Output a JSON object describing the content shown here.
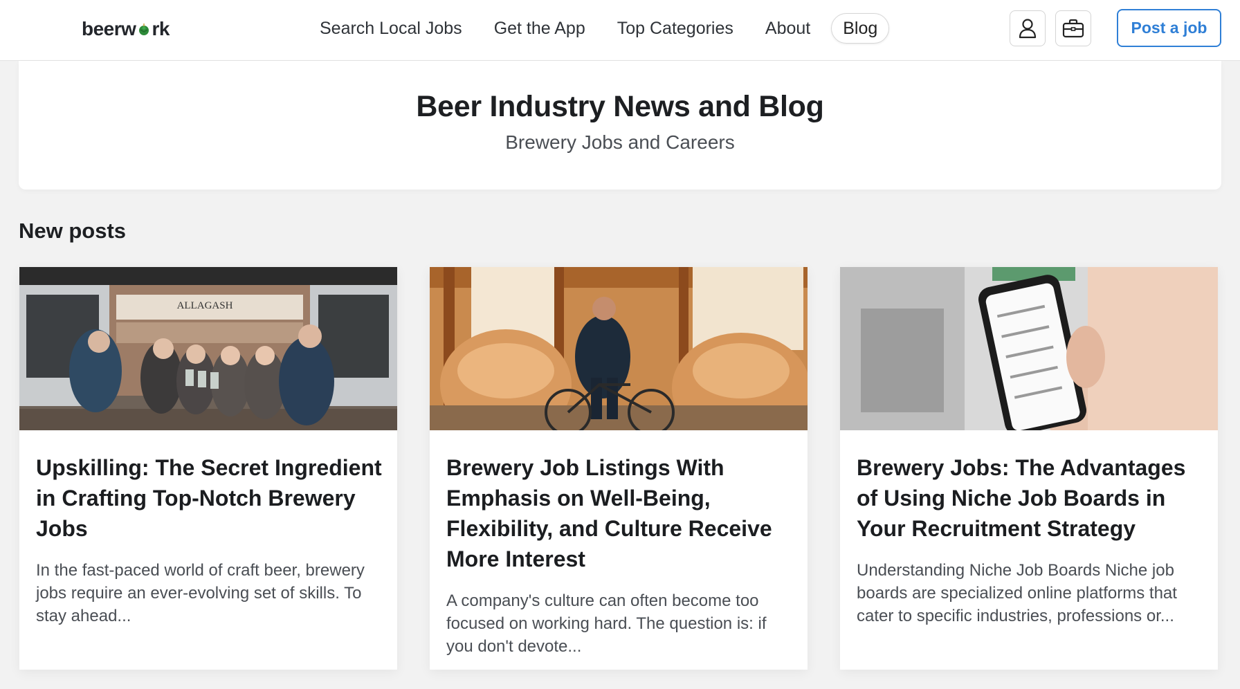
{
  "brand": {
    "logo_text_a": "beerw",
    "logo_text_b": "rk"
  },
  "nav": {
    "items": [
      "Search Local Jobs",
      "Get the App",
      "Top Categories",
      "About",
      "Blog"
    ],
    "active": "Blog"
  },
  "header_actions": {
    "account_icon": "user-icon",
    "jobs_icon": "briefcase-icon",
    "post_job_label": "Post a job"
  },
  "hero": {
    "title": "Beer Industry News and Blog",
    "subtitle": "Brewery Jobs and Careers"
  },
  "section": {
    "title": "New posts"
  },
  "posts": [
    {
      "title": "Upskilling: The Secret Ingredient in Crafting Top-Notch Brewery Jobs",
      "excerpt": "In the fast-paced world of craft beer, brewery jobs require an ever-evolving set of skills. To stay ahead...",
      "image_sign": "ALLAGASH"
    },
    {
      "title": "Brewery Job Listings With Emphasis on Well-Being, Flexibility, and Culture Receive More Interest",
      "excerpt": "A company's culture can often become too focused on working hard. The question is: if you don't devote..."
    },
    {
      "title": "Brewery Jobs: The Advantages of Using Niche Job Boards in Your Recruitment Strategy",
      "excerpt": "Understanding Niche Job Boards Niche job boards are specialized online platforms that cater to specific industries, professions or..."
    }
  ],
  "colors": {
    "accent": "#2f7fd6",
    "logo_green": "#2e8b3a",
    "background": "#f2f2f2"
  }
}
